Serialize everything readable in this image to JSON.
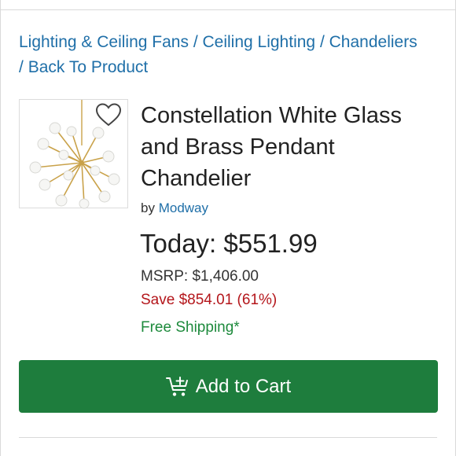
{
  "breadcrumb": {
    "items": [
      "Lighting & Ceiling Fans",
      "Ceiling Lighting",
      "Chandeliers",
      "Back To Product"
    ],
    "separator": "/"
  },
  "product": {
    "title": "Constellation White Glass and Brass Pendant Chandelier",
    "by_label": "by",
    "brand": "Modway",
    "image_icon": "chandelier-image",
    "wishlist_icon": "heart-icon"
  },
  "pricing": {
    "today": "Today: $551.99",
    "msrp_label": "MSRP:",
    "msrp_value": "$1,406.00",
    "save": "Save $854.01 (61%)",
    "shipping": "Free Shipping*"
  },
  "cart": {
    "label": "Add to Cart",
    "icon": "add-to-cart-icon"
  },
  "colors": {
    "link": "#1f6fa8",
    "save": "#b4161b",
    "shipping": "#1d8a3c",
    "button": "#1e7d3d"
  }
}
